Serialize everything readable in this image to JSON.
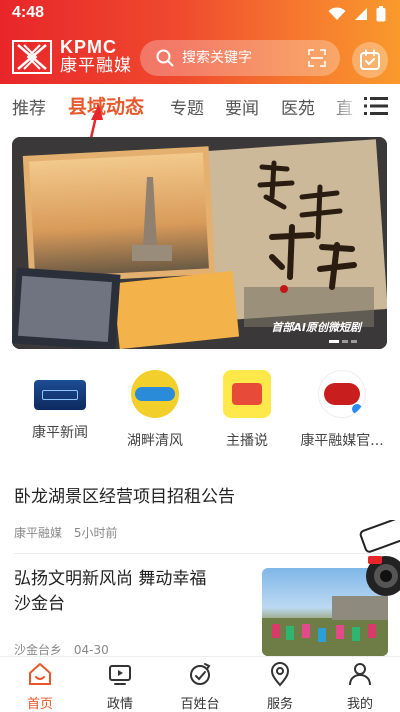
{
  "status_bar": {
    "time": "4:48"
  },
  "header": {
    "logo_en": "KPMC",
    "logo_cn": "康平融媒",
    "search_placeholder": "搜索关键字",
    "colors": {
      "gradient_start": "#e8262a",
      "gradient_end": "#f99a2c"
    }
  },
  "tabs": [
    {
      "label": "推荐",
      "active": false
    },
    {
      "label": "县域动态",
      "active": true
    },
    {
      "label": "专题",
      "active": false
    },
    {
      "label": "要闻",
      "active": false
    },
    {
      "label": "医苑",
      "active": false
    },
    {
      "label": "直",
      "active": false
    }
  ],
  "banner": {
    "calligraphy": "康平寻踪",
    "caption": "首部AI原创微短剧"
  },
  "quick_links": [
    {
      "label": "康平新闻",
      "icon": "kangping-news-icon"
    },
    {
      "label": "湖畔清风",
      "icon": "lakeside-breeze-icon"
    },
    {
      "label": "主播说",
      "icon": "anchor-says-icon"
    },
    {
      "label": "康平融媒官...",
      "icon": "kangping-media-official-icon"
    }
  ],
  "news": [
    {
      "title": "卧龙湖景区经营项目招租公告",
      "source": "康平融媒",
      "time": "5小时前"
    },
    {
      "title_line1": "弘扬文明新风尚  舞动幸福",
      "title_line2": "沙金台",
      "source": "沙金台乡",
      "time": "04-30"
    }
  ],
  "float_button": {
    "label": "随手拍"
  },
  "bottom_nav": [
    {
      "label": "首页",
      "icon": "home-icon",
      "active": true
    },
    {
      "label": "政情",
      "icon": "tv-icon",
      "active": false
    },
    {
      "label": "百姓台",
      "icon": "people-icon",
      "active": false
    },
    {
      "label": "服务",
      "icon": "location-icon",
      "active": false
    },
    {
      "label": "我的",
      "icon": "user-icon",
      "active": false
    }
  ],
  "accent_color": "#e8582b"
}
